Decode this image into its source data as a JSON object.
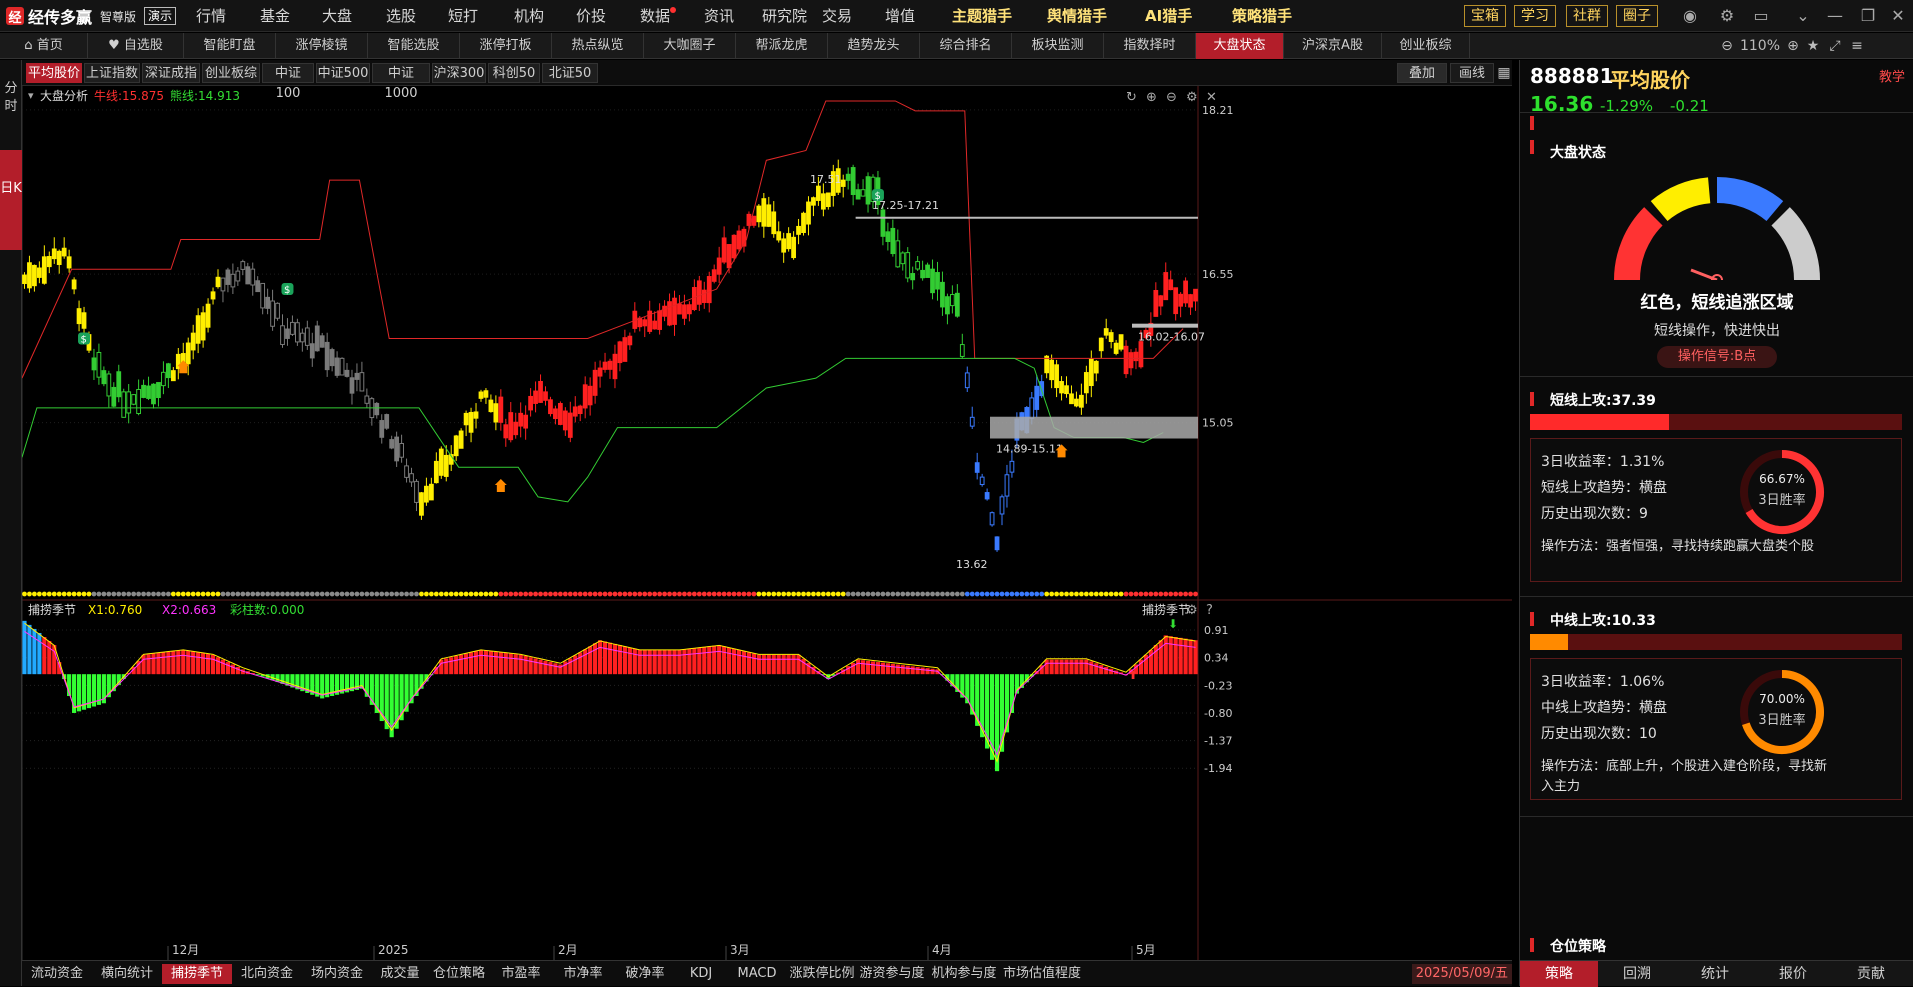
{
  "app": {
    "name": "经传多赢",
    "edition": "智尊版",
    "demo": "演示",
    "logo_icon": "app-logo-icon"
  },
  "topmenu": [
    "行情",
    "基金",
    "大盘",
    "选股",
    "短打",
    "机构",
    "价投",
    "数据",
    "资讯",
    "研究院",
    "交易",
    "增值"
  ],
  "topmenu_hl": [
    "主题猎手",
    "舆情猎手",
    "AI猎手",
    "策略猎手"
  ],
  "topbtns": [
    "宝箱",
    "学习",
    "社群",
    "圈子"
  ],
  "win_icons": [
    "user-icon",
    "gear-icon",
    "window-icon",
    "chevron-down-icon",
    "minimize-icon",
    "restore-icon",
    "close-icon"
  ],
  "navtabs": [
    "首页",
    "自选股",
    "智能盯盘",
    "涨停棱镜",
    "智能选股",
    "涨停打板",
    "热点纵览",
    "大咖圈子",
    "帮派龙虎",
    "趋势龙头",
    "综合排名",
    "板块监测",
    "指数择时",
    "大盘状态",
    "沪深京A股",
    "创业板综"
  ],
  "nav_active": 13,
  "zoom": "110%",
  "leftstrip": {
    "fen": "分时",
    "ri": "日K"
  },
  "subtabs": [
    "平均股价",
    "上证指数",
    "深证成指",
    "创业板综",
    "中证100",
    "中证500",
    "中证1000",
    "沪深300",
    "科创50",
    "北证50"
  ],
  "overlay": "叠加",
  "draw": "画线",
  "main_legend": {
    "name": "大盘分析",
    "bull": "牛线:15.875",
    "bear": "熊线:14.913"
  },
  "price_axis": [
    "18.21",
    "16.55",
    "15.05"
  ],
  "annotations": {
    "high": "17.51",
    "range1": "17.25-17.21",
    "range2": "16.02-16.07",
    "range3": "14.89-15.11",
    "low": "13.62"
  },
  "sub_legend": {
    "name": "捕捞季节",
    "x1": "X1:0.760",
    "x2": "X2:0.663",
    "bar": "彩柱数:0.000",
    "right": "捕捞季节"
  },
  "sub_axis": [
    "0.91",
    "0.34",
    "-0.23",
    "-0.80",
    "-1.37",
    "-1.94"
  ],
  "date_axis": [
    "12月",
    "2025",
    "2月",
    "3月",
    "4月",
    "5月"
  ],
  "bottomtabs": [
    "流动资金",
    "横向统计",
    "捕捞季节",
    "北向资金",
    "场内资金",
    "成交量",
    "仓位策略",
    "市盈率",
    "市净率",
    "破净率",
    "KDJ",
    "MACD",
    "涨跌停比例",
    "游资参与度",
    "机构参与度",
    "市场估值程度"
  ],
  "bottom_active": 2,
  "current_date": "2025/05/09/五",
  "right": {
    "code": "888881",
    "name": "平均股价",
    "price": "16.36",
    "pct": "-1.29%",
    "chg": "-0.21",
    "teach": "教学",
    "market_title": "大盘状态",
    "status": "红色，短线追涨区域",
    "status_desc": "短线操作，快进快出",
    "signal": "操作信号:B点",
    "short": {
      "title": "短线上攻:37.39",
      "ret": "3日收益率：1.31%",
      "trend": "短线上攻趋势：横盘",
      "count": "历史出现次数：9",
      "method": "操作方法：强者恒强，寻找持续跑赢大盘类个股",
      "win": "66.67%",
      "win_label": "3日胜率",
      "win_value": 66.67,
      "bar_fill": 0.3739
    },
    "mid": {
      "title": "中线上攻:10.33",
      "ret": "3日收益率：1.06%",
      "trend": "中线上攻趋势：横盘",
      "count": "历史出现次数：10",
      "method1": "操作方法：底部上升，个股进入建仓阶段，寻找新",
      "method2": "入主力",
      "win": "70.00%",
      "win_label": "3日胜率",
      "win_value": 70.0,
      "bar_fill": 0.1033
    },
    "position_title": "仓位策略",
    "tabs": [
      "策略",
      "回溯",
      "统计",
      "报价",
      "贡献"
    ]
  },
  "colors": {
    "up": "#ff2020",
    "up_yellow": "#ffee00",
    "down_gray": "#7a7a7a",
    "down_green": "#33cc33",
    "bull": "#e02828",
    "bear": "#33cc33",
    "accent": "#b31e2a"
  }
}
